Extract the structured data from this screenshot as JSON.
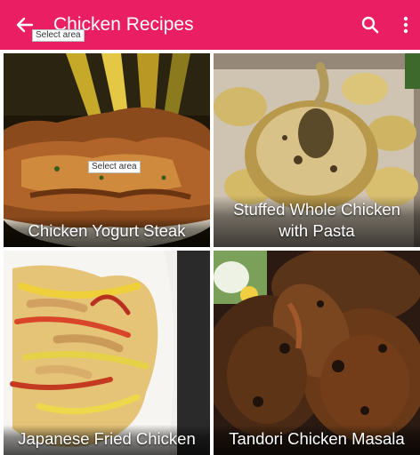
{
  "app_bar": {
    "title": "Chicken Recipes",
    "background": "#e91e63",
    "icons": {
      "back": "arrow-back-icon",
      "search": "search-icon",
      "more": "more-vert-icon"
    }
  },
  "overlays": {
    "select_area_top": "Select area",
    "select_area_mid": "Select area"
  },
  "recipes": [
    {
      "title": "Chicken Yogurt Steak"
    },
    {
      "title": "Stuffed Whole Chicken with Pasta"
    },
    {
      "title": "Japanese Fried Chicken"
    },
    {
      "title": "Tandori Chicken Masala"
    }
  ]
}
